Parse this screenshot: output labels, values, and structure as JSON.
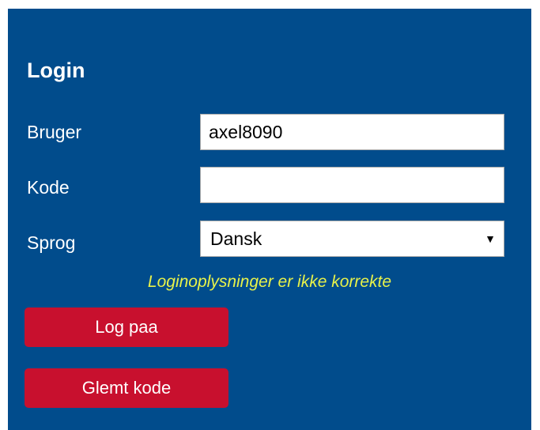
{
  "login": {
    "title": "Login",
    "user_label": "Bruger",
    "user_value": "axel8090",
    "code_label": "Kode",
    "code_value": "",
    "language_label": "Sprog",
    "language_selected": "Dansk",
    "error_message": "Loginoplysninger er ikke korrekte",
    "login_button": "Log paa",
    "forgot_button": "Glemt kode"
  },
  "icons": {
    "dropdown": "chevron-down-icon"
  },
  "colors": {
    "panel_background": "#014c8c",
    "button_background": "#c8102e",
    "error_text": "#e8f24a",
    "label_text": "#ffffff"
  }
}
